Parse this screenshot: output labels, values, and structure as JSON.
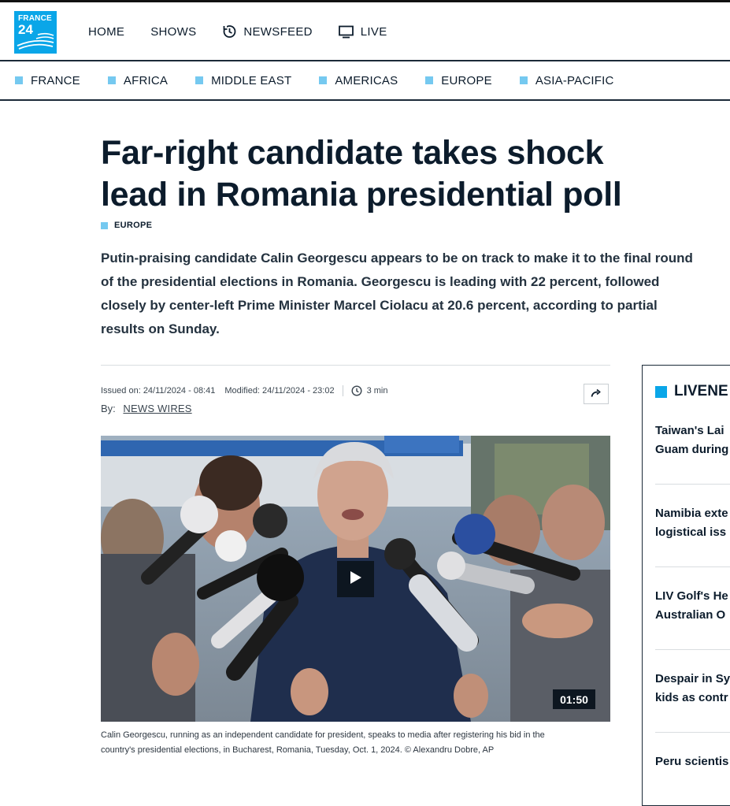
{
  "brand": {
    "logo_line1": "FRANCE",
    "logo_line2": "24",
    "accent": "#0aa6e8",
    "category_square": "#75c9f0"
  },
  "nav": [
    {
      "label": "HOME",
      "icon": ""
    },
    {
      "label": "SHOWS",
      "icon": ""
    },
    {
      "label": "NEWSFEED",
      "icon": "history-icon"
    },
    {
      "label": "LIVE",
      "icon": "tv-icon"
    }
  ],
  "categories": [
    "FRANCE",
    "AFRICA",
    "MIDDLE EAST",
    "AMERICAS",
    "EUROPE",
    "ASIA-PACIFIC"
  ],
  "article": {
    "headline_line1": "Far-right candidate takes shock",
    "headline_line2": "lead in Romania presidential poll",
    "tag": "EUROPE",
    "lede": "Putin-praising candidate Calin Georgescu appears to be on track to make it to the final round of the presidential elections in Romania. Georgescu is leading with 22 percent, followed closely by center-left Prime Minister Marcel Ciolacu at 20.6 percent, according to partial results on Sunday.",
    "issued": "Issued on: 24/11/2024 - 08:41",
    "modified": "Modified: 24/11/2024 - 23:02",
    "read_time": "3 min",
    "by_label": "By:",
    "author": "NEWS WIRES",
    "video_duration": "01:50",
    "caption": "Calin Georgescu, running as an independent candidate for president, speaks to media after registering his bid in the country's presidential elections, in Bucharest, Romania, Tuesday, Oct. 1, 2024.  © Alexandru Dobre, AP"
  },
  "livefeed": {
    "title": "LIVENE",
    "items": [
      {
        "line1": "Taiwan's Lai",
        "line2": "Guam during"
      },
      {
        "line1": "Namibia exte",
        "line2": "logistical iss"
      },
      {
        "line1": "LIV Golf's He",
        "line2": "Australian O"
      },
      {
        "line1": "Despair in Sy",
        "line2": "kids as contr"
      },
      {
        "line1": "Peru scientis",
        "line2": ""
      }
    ]
  }
}
